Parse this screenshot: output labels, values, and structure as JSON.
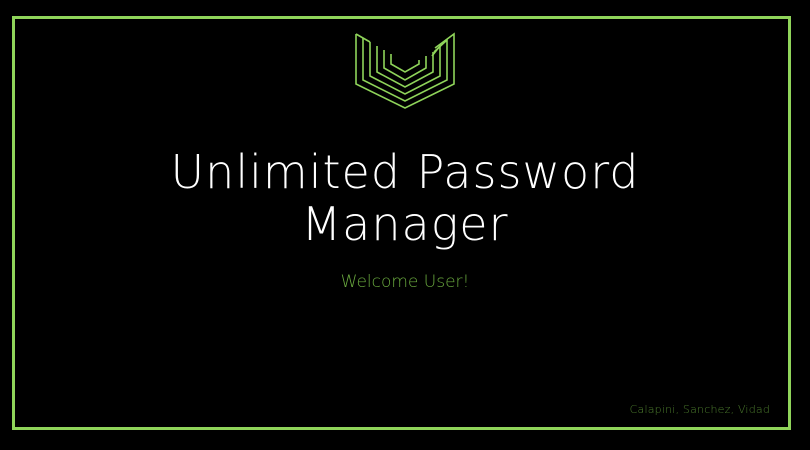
{
  "app": {
    "title_line1": "Unlimited Password",
    "title_line2": "Manager",
    "welcome": "Welcome User!",
    "credits": "Calapini, Sanchez, Vidad"
  },
  "colors": {
    "accent": "#8fd45a",
    "welcome_text": "#6bab3f",
    "credits_text": "#4e7f2e",
    "background": "#000000",
    "title_text": "#ffffff"
  },
  "icons": {
    "logo": "shield-u-logo-icon"
  }
}
